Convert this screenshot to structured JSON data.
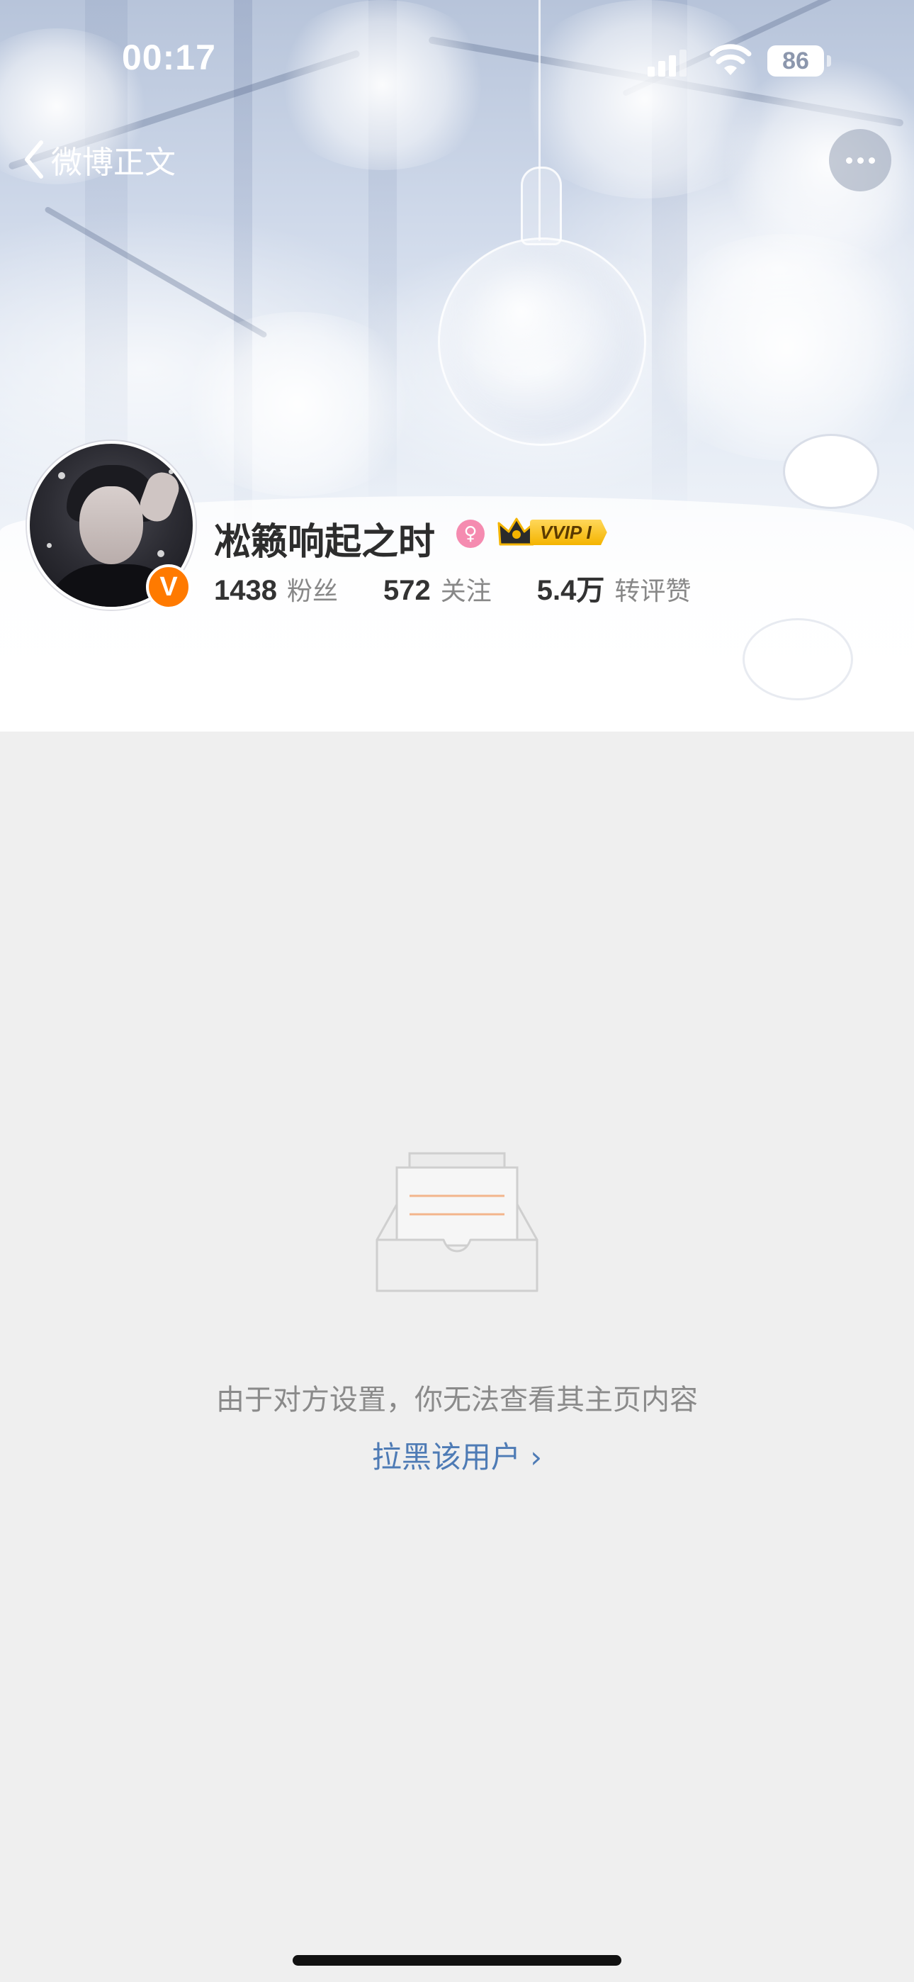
{
  "status_bar": {
    "time": "00:17",
    "battery": "86"
  },
  "nav": {
    "back_label": "微博正文",
    "back_icon": "chevron-left-icon",
    "more_icon": "ellipsis-icon"
  },
  "profile": {
    "username": "凇籁响起之时",
    "verified_badge": "V",
    "vip_label": "VVIP I",
    "stats": [
      {
        "value": "1438",
        "label": "粉丝"
      },
      {
        "value": "572",
        "label": "关注"
      },
      {
        "value": "5.4万",
        "label": "转评赞"
      }
    ]
  },
  "empty_state": {
    "message": "由于对方设置，你无法查看其主页内容",
    "block_link": "拉黑该用户 ›"
  },
  "colors": {
    "page_bg": "#efefef",
    "link": "#4e7bb5",
    "verified": "#ff7a00",
    "vip_gold": "#f4b400",
    "gender": "#f58bb0"
  }
}
